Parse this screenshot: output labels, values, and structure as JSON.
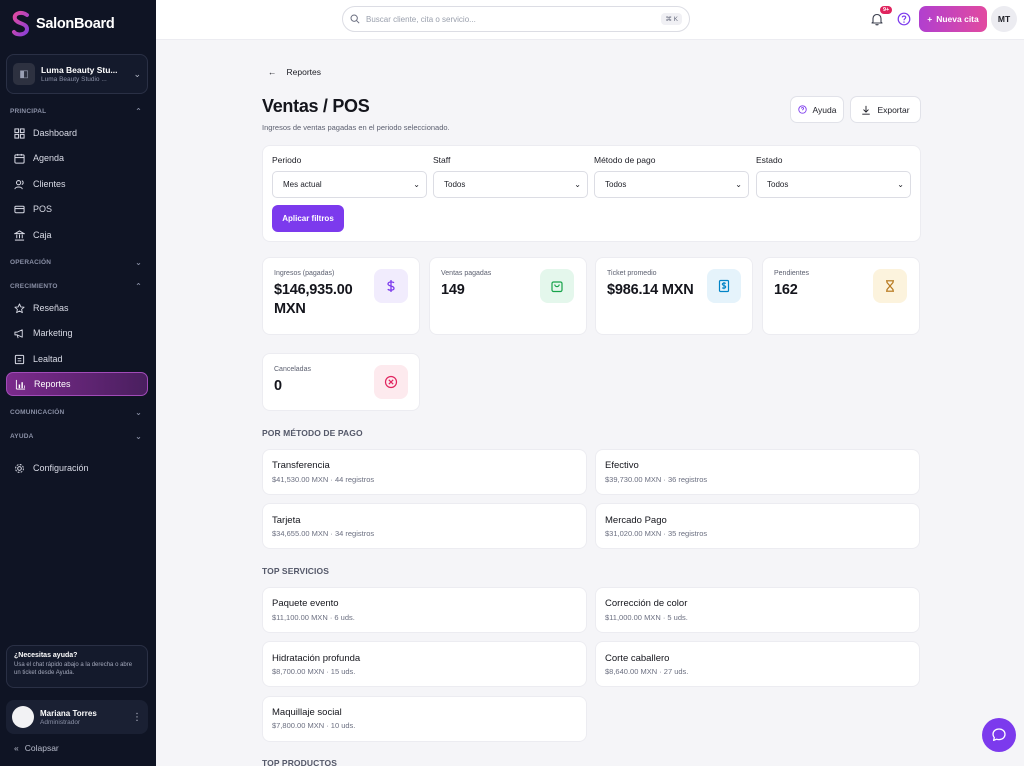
{
  "brand": {
    "name": "SalonBoard"
  },
  "workspace": {
    "name": "Luma Beauty Stu...",
    "sub": "Luma Beauty Studio ..."
  },
  "sidebar": {
    "sections": {
      "principal": "PRINCIPAL",
      "operacion": "OPERACIÓN",
      "crecimiento": "CRECIMIENTO",
      "comunicacion": "COMUNICACIÓN",
      "ayuda": "AYUDA"
    },
    "items": {
      "dashboard": "Dashboard",
      "agenda": "Agenda",
      "clientes": "Clientes",
      "pos": "POS",
      "caja": "Caja",
      "resenas": "Reseñas",
      "marketing": "Marketing",
      "lealtad": "Lealtad",
      "reportes": "Reportes",
      "configuracion": "Configuración"
    },
    "help": {
      "title": "¿Necesitas ayuda?",
      "text": "Usa el chat rápido abajo a la derecha o abre un ticket desde Ayuda."
    },
    "user": {
      "name": "Mariana Torres",
      "role": "Administrador"
    },
    "collapse": "Colapsar"
  },
  "topbar": {
    "search_placeholder": "Buscar cliente, cita o servicio...",
    "shortcut": "⌘ K",
    "notif_badge": "9+",
    "new_button": "Nueva cita",
    "avatar_initials": "MT"
  },
  "page": {
    "back_label": "Reportes",
    "title": "Ventas / POS",
    "subtitle": "Ingresos de ventas pagadas en el periodo seleccionado.",
    "help_button": "Ayuda",
    "export_button": "Exportar"
  },
  "filters": {
    "periodo": {
      "label": "Periodo",
      "value": "Mes actual"
    },
    "staff": {
      "label": "Staff",
      "value": "Todos"
    },
    "metodo": {
      "label": "Método de pago",
      "value": "Todos"
    },
    "estado": {
      "label": "Estado",
      "value": "Todos"
    },
    "apply": "Aplicar filtros"
  },
  "stats": {
    "ingresos": {
      "label": "Ingresos (pagadas)",
      "value_line1": "$146,935.00",
      "value_line2": "MXN"
    },
    "ventas": {
      "label": "Ventas pagadas",
      "value": "149"
    },
    "ticket": {
      "label": "Ticket promedio",
      "value": "$986.14 MXN"
    },
    "pendientes": {
      "label": "Pendientes",
      "value": "162"
    },
    "canceladas": {
      "label": "Canceladas",
      "value": "0"
    }
  },
  "payment_methods": {
    "title": "POR MÉTODO DE PAGO",
    "items": [
      {
        "name": "Transferencia",
        "detail": "$41,530.00 MXN · 44 registros"
      },
      {
        "name": "Efectivo",
        "detail": "$39,730.00 MXN · 36 registros"
      },
      {
        "name": "Tarjeta",
        "detail": "$34,655.00 MXN · 34 registros"
      },
      {
        "name": "Mercado Pago",
        "detail": "$31,020.00 MXN · 35 registros"
      }
    ]
  },
  "top_services": {
    "title": "TOP SERVICIOS",
    "items": [
      {
        "name": "Paquete evento",
        "detail": "$11,100.00 MXN · 6 uds."
      },
      {
        "name": "Corrección de color",
        "detail": "$11,000.00 MXN · 5 uds."
      },
      {
        "name": "Hidratación profunda",
        "detail": "$8,700.00 MXN · 15 uds."
      },
      {
        "name": "Corte caballero",
        "detail": "$8,640.00 MXN · 27 uds."
      },
      {
        "name": "Maquillaje social",
        "detail": "$7,800.00 MXN · 10 uds."
      }
    ]
  },
  "top_products": {
    "title": "TOP PRODUCTOS"
  },
  "colors": {
    "accent": "#7c3aed",
    "sidebar_bg": "#0f1424",
    "active_nav": "#7b2b8c"
  }
}
